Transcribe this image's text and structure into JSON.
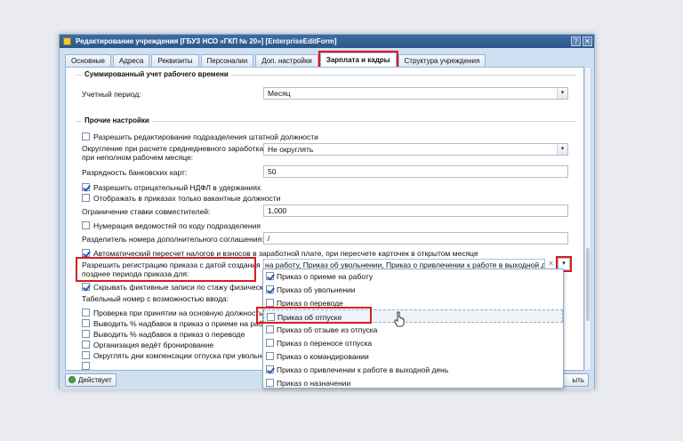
{
  "window": {
    "title": "Редактирование учреждения [ГБУЗ НСО «ГКП № 20»] [EnterpriseEditForm]"
  },
  "tabs": [
    {
      "label": "Основные"
    },
    {
      "label": "Адреса"
    },
    {
      "label": "Реквизиты"
    },
    {
      "label": "Персоналии"
    },
    {
      "label": "Доп. настройки"
    },
    {
      "label": "Зарплата и кадры",
      "active": true
    },
    {
      "label": "Структура учреждения"
    }
  ],
  "section1": {
    "title": "Суммированный учет рабочего времени",
    "period_label": "Учетный период:",
    "period_value": "Месяц"
  },
  "section2": {
    "title": "Прочие настройки",
    "allow_edit_units": "Разрешить редактирование подразделения штатной должности",
    "rounding_label_1": "Округление при расчете среднедневного заработка",
    "rounding_label_2": "при неполном рабочем месяце:",
    "rounding_value": "Не округлять",
    "bank_digits_label": "Разрядность банковских карт:",
    "bank_digits_value": "50",
    "negative_ndfl": "Разрешить отрицательный НДФЛ в удержаниях",
    "only_vacant": "Отображать в приказах только вакантные должности",
    "rate_limit_label": "Ограничение ставки совместителей:",
    "rate_limit_value": "1,000",
    "numbering_by_code": "Нумерация ведомостей по коду подразделения",
    "separator_label": "Разделитель номера дополнительного соглашения:",
    "separator_value": "/",
    "auto_recalc": "Автоматический пересчет налогов и взносов в заработной плате, при пересчете карточек в открытом месяце",
    "allow_reg_label_1": "Разрешить регистрацию приказа с датой создания",
    "allow_reg_label_2": "позднее периода приказа для:",
    "allow_reg_value": "на работу, Приказ об увольнении, Приказ о привлечении к работе в выходной день",
    "hide_fictive": "Скрывать фиктивные записи по стажу физического",
    "tab_number_label": "Табельный номер с возможностью ввода:",
    "check_on_hire": "Проверка при принятии на основную должность",
    "print_pct_hire": "Выводить % надбавок в приказ о приеме на работу",
    "print_pct_transfer": "Выводить % надбавок в приказ о переводе",
    "booking_org": "Организация ведёт бронирование",
    "round_comp_days": "Округлять дни компенсации отпуска при увольнении"
  },
  "dropdown": {
    "items": [
      {
        "label": "Приказ о приеме на работу",
        "checked": true
      },
      {
        "label": "Приказ об увольнении",
        "checked": true
      },
      {
        "label": "Приказ о переводе",
        "checked": false
      },
      {
        "label": "Приказ об отпуске",
        "checked": false
      },
      {
        "label": "Приказ об отзыве из отпуска",
        "checked": false
      },
      {
        "label": "Приказ о переносе отпуска",
        "checked": false
      },
      {
        "label": "Приказ о командировании",
        "checked": false
      },
      {
        "label": "Приказ о привлечении к работе в выходной день",
        "checked": true
      },
      {
        "label": "Приказ о назначении",
        "checked": false
      }
    ]
  },
  "footer": {
    "actions_label": "Действует",
    "close_label_partial": "ыть"
  },
  "icons": {
    "app": "window-app-icon",
    "help": "help-icon",
    "close": "close-icon",
    "combo_trigger": "chevron-down-icon",
    "clear": "clear-icon"
  }
}
